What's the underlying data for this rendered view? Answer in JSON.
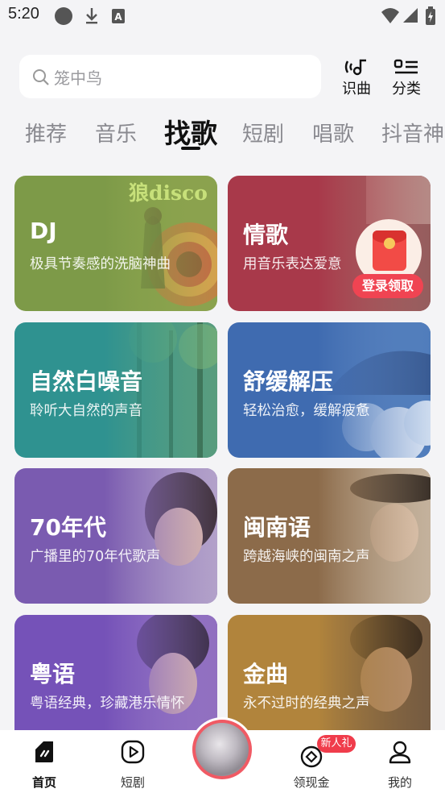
{
  "status_bar": {
    "time": "5:20",
    "icons": [
      "record-dot-icon",
      "download-icon",
      "font-a-icon",
      "wifi-icon",
      "signal-icon",
      "battery-charging-icon"
    ]
  },
  "search": {
    "placeholder": "笼中鸟"
  },
  "top_buttons": [
    {
      "label": "识曲",
      "icon": "music-recognize-icon"
    },
    {
      "label": "分类",
      "icon": "category-icon"
    }
  ],
  "tabs": [
    {
      "label": "推荐",
      "active": false
    },
    {
      "label": "音乐",
      "active": false
    },
    {
      "label": "找歌",
      "active": true
    },
    {
      "label": "短剧",
      "active": false
    },
    {
      "label": "唱歌",
      "active": false
    },
    {
      "label": "抖音神",
      "active": false
    }
  ],
  "cards": [
    {
      "title": "DJ",
      "subtitle": "极具节奏感的洗脑神曲",
      "color": "#7d9a48",
      "art_text": "狼disco"
    },
    {
      "title": "情歌",
      "subtitle": "用音乐表达爱意",
      "color": "#a8394a"
    },
    {
      "title": "自然白噪音",
      "subtitle": "聆听大自然的声音",
      "color": "#2f9290"
    },
    {
      "title": "舒缓解压",
      "subtitle": "轻松治愈，缓解疲惫",
      "color": "#3f6bb0"
    },
    {
      "title": "70年代",
      "subtitle": "广播里的70年代歌声",
      "color": "#7a5bb0"
    },
    {
      "title": "闽南语",
      "subtitle": "跨越海峡的闽南之声",
      "color": "#8c6b4a"
    },
    {
      "title": "粤语",
      "subtitle": "粤语经典，珍藏港乐情怀",
      "color": "#7552b8"
    },
    {
      "title": "金曲",
      "subtitle": "永不过时的经典之声",
      "color": "#b1843c"
    }
  ],
  "promo": {
    "label": "登录领取"
  },
  "bottom_nav": [
    {
      "label": "首页",
      "icon": "home-icon",
      "active": true
    },
    {
      "label": "短剧",
      "icon": "play-icon",
      "active": false
    },
    {
      "label": "领现金",
      "icon": "coin-icon",
      "active": false
    },
    {
      "label": "我的",
      "icon": "profile-icon",
      "active": false
    }
  ],
  "badge": "新人礼"
}
